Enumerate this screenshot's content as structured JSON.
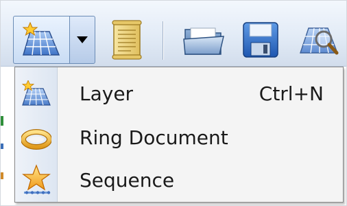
{
  "toolbar": {
    "new_layer_icon": "grid-star-icon",
    "dropdown_icon": "chevron-down-icon",
    "document_icon": "scroll-document-icon",
    "open_icon": "open-folder-icon",
    "save_icon": "floppy-disk-icon",
    "find_icon": "magnifier-grid-icon"
  },
  "menu": {
    "items": [
      {
        "label": "Layer",
        "shortcut": "Ctrl+N",
        "icon": "layer-grid-icon"
      },
      {
        "label": "Ring Document",
        "shortcut": "",
        "icon": "ring-icon"
      },
      {
        "label": "Sequence",
        "shortcut": "",
        "icon": "sequence-star-icon"
      }
    ]
  },
  "colors": {
    "menu_background": "#f4f4f4",
    "gutter": "#dde6f2",
    "toolbar_top": "#f3f7fd",
    "toolbar_bottom": "#d2ddec",
    "button_border": "#6a8bb5"
  }
}
